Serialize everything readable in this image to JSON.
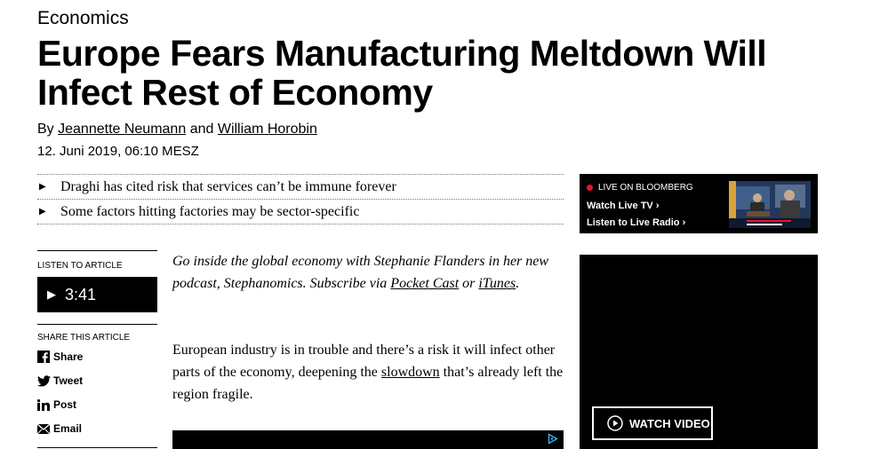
{
  "section": "Economics",
  "headline": "Europe Fears Manufacturing Meltdown Will Infect Rest of Economy",
  "byline": {
    "by": "By",
    "author1": "Jeannette Neumann",
    "and": "and",
    "author2": "William Horobin"
  },
  "date": "12. Juni 2019, 06:10 MESZ",
  "bullets": [
    "Draghi has cited risk that services can’t be immune forever",
    "Some factors hitting factories may be sector-specific"
  ],
  "listen": {
    "label": "LISTEN TO ARTICLE",
    "duration": "3:41"
  },
  "share": {
    "label": "SHARE THIS ARTICLE",
    "items": [
      "Share",
      "Tweet",
      "Post",
      "Email"
    ]
  },
  "promo": {
    "text1": "Go inside the global economy with Stephanie Flanders in her new podcast, Stephanomics. Subscribe via ",
    "link1": "Pocket Cast",
    "text2": " or ",
    "link2": "iTunes",
    "text3": "."
  },
  "body": {
    "text1": "European industry is in trouble and there’s a risk it will infect other parts of the economy, deepening the ",
    "link": "slowdown",
    "text2": " that’s already left the region fragile."
  },
  "live": {
    "label": "LIVE ON BLOOMBERG",
    "watch": "Watch Live TV",
    "listen": "Listen to Live Radio"
  },
  "video": {
    "button": "WATCH VIDEO"
  },
  "colors": {
    "live_dot": "#e8132a",
    "panel_bg": "#000000"
  }
}
